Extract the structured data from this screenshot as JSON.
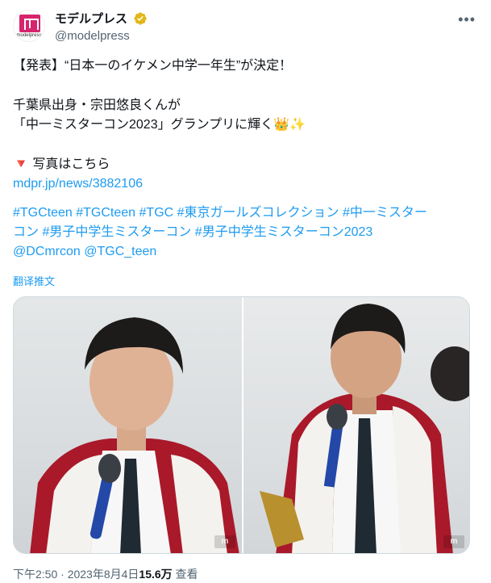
{
  "account": {
    "display_name": "モデルプレス",
    "handle": "@modelpress",
    "avatar_text": "modelpress"
  },
  "tweet": {
    "line1": "【発表】“日本一のイケメン中学一年生”が決定！",
    "line2": "千葉県出身・宗田悠良くんが",
    "line3": "「中一ミスターコン2023」グランプリに輝く👑✨",
    "line4_icon": "🔻",
    "line4_text": "写真はこちら",
    "link": "mdpr.jp/news/3882106",
    "hashtags_line1": "#TGCteen #TGCteen #TGC #東京ガールズコレクション #中一ミスター",
    "hashtags_line2": "コン #男子中学生ミスターコン #男子中学生ミスターコン2023",
    "mentions": "@DCmrcon @TGC_teen",
    "translate_label": "翻译推文"
  },
  "media": {
    "watermark_left": "m",
    "watermark_right": "m"
  },
  "meta": {
    "timestamp": "下午2:50 · 2023年8月4日",
    "views_count": "15.6万",
    "views_label": "查看"
  },
  "colors": {
    "link": "#1d9bf0",
    "secondary_text": "#536471",
    "primary_text": "#0f1419",
    "brand": "#d6246e",
    "verified_gold": "#e2b719"
  }
}
